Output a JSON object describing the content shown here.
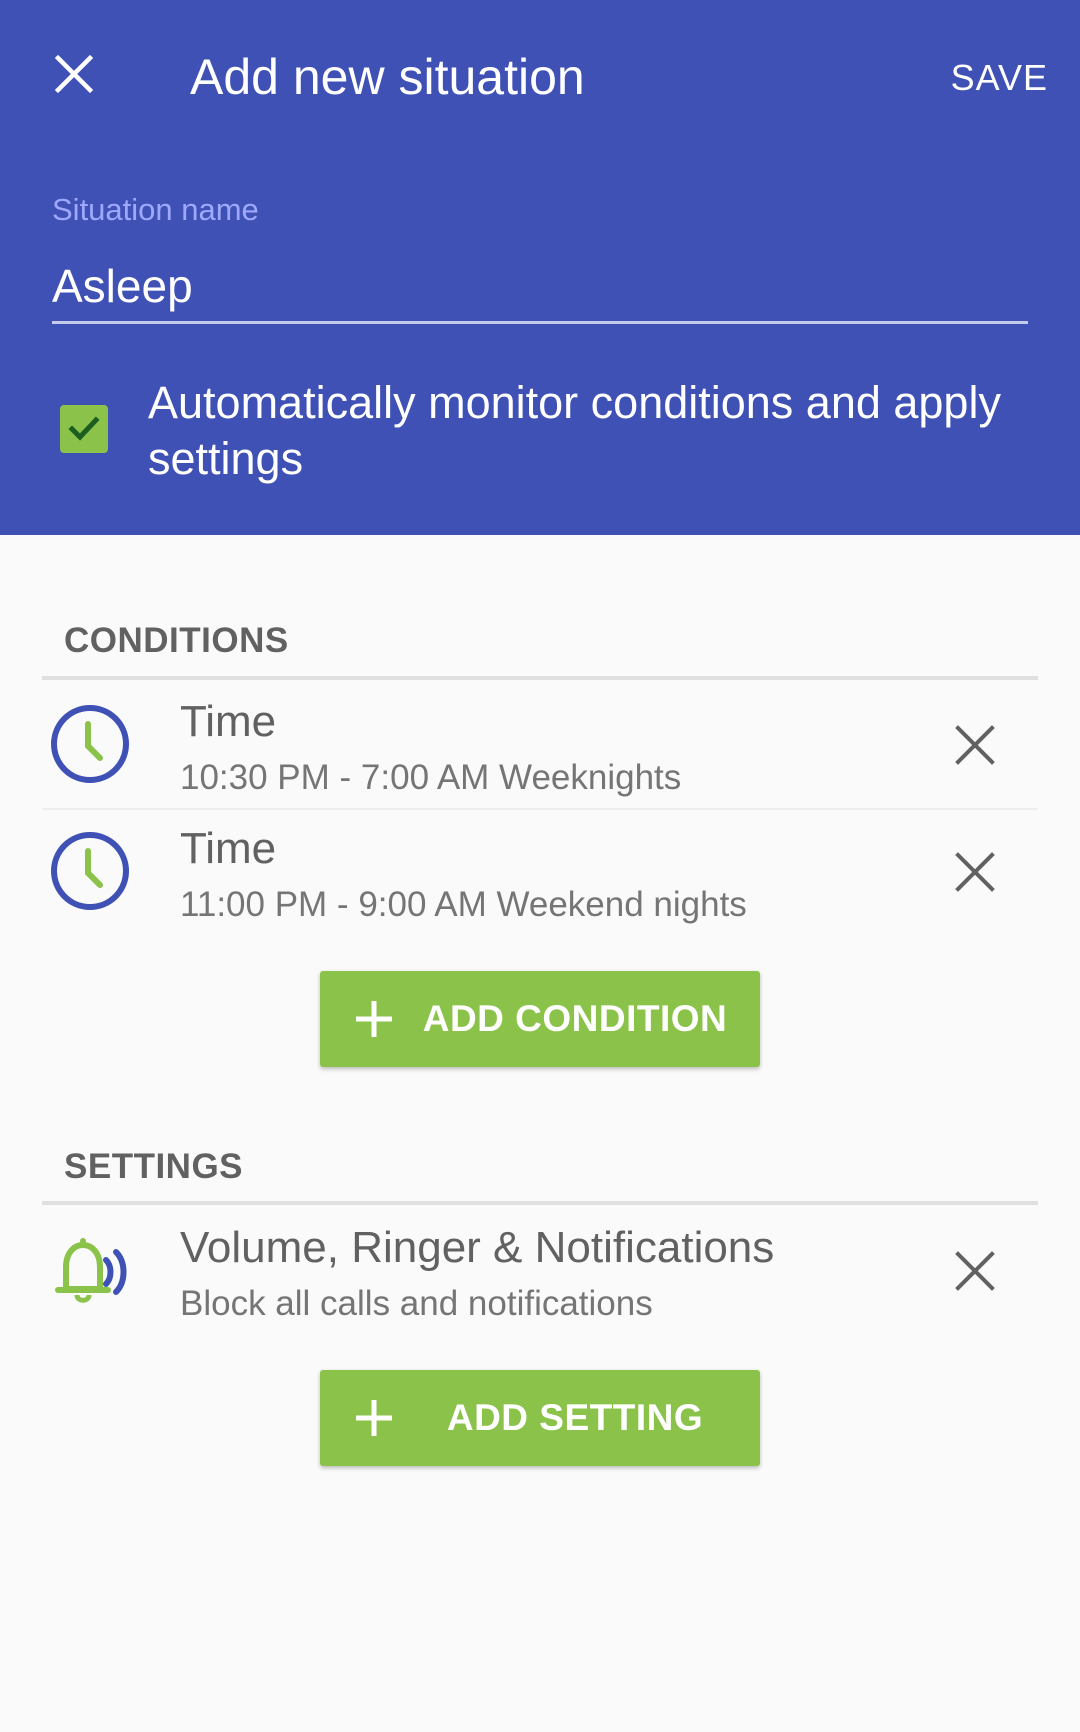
{
  "header": {
    "title": "Add new situation",
    "close_icon": "close-icon",
    "save_label": "SAVE",
    "name_label": "Situation name",
    "name_value": "Asleep",
    "auto_monitor_checked": true,
    "auto_monitor_label": "Automatically monitor conditions and apply settings"
  },
  "conditions": {
    "section_title": "CONDITIONS",
    "items": [
      {
        "icon": "clock-icon",
        "title": "Time",
        "subtitle": "10:30 PM - 7:00 AM Weeknights"
      },
      {
        "icon": "clock-icon",
        "title": "Time",
        "subtitle": "11:00 PM - 9:00 AM Weekend nights"
      }
    ],
    "add_label": "ADD CONDITION"
  },
  "settings": {
    "section_title": "SETTINGS",
    "items": [
      {
        "icon": "bell-ringing-icon",
        "title": "Volume, Ringer & Notifications",
        "subtitle": "Block all calls and notifications"
      }
    ],
    "add_label": "ADD SETTING"
  },
  "colors": {
    "primary": "#3f51b5",
    "accent_green": "#8bc34a",
    "background": "#fafafa",
    "text_secondary": "#616161"
  }
}
